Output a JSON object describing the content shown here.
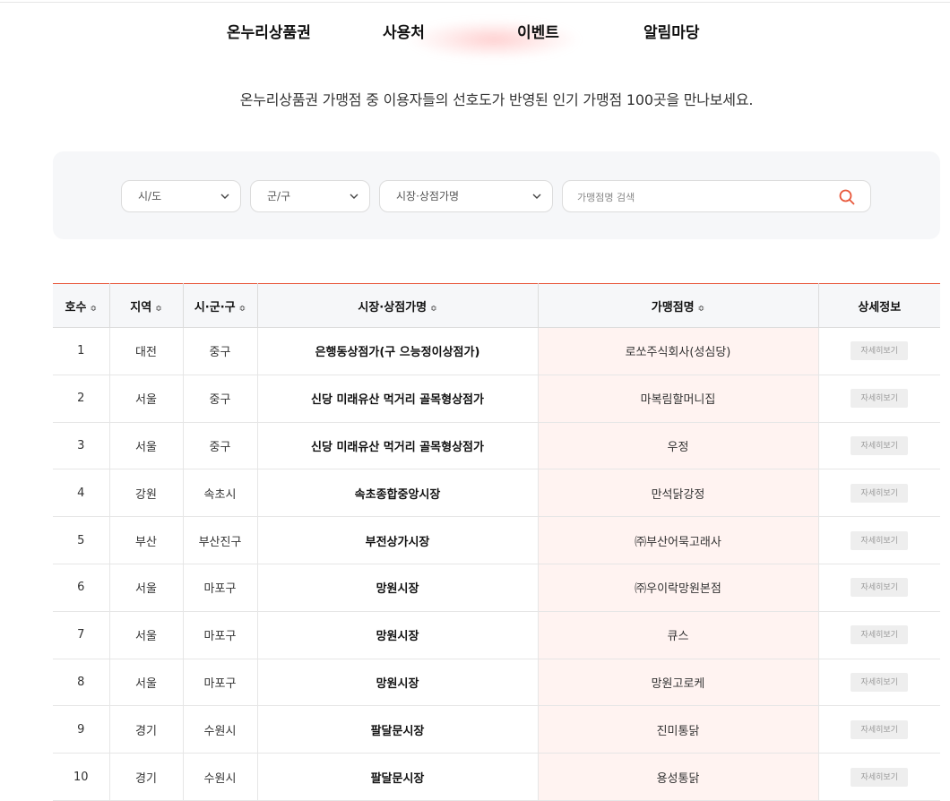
{
  "nav": {
    "items": [
      "온누리상품권",
      "사용처",
      "이벤트",
      "알림마당"
    ]
  },
  "subtitle": "온누리상품권 가맹점 중 이용자들의 선호도가 반영된 인기 가맹점 100곳을 만나보세요.",
  "filters": {
    "sido": "시/도",
    "gungu": "군/구",
    "market": "시장·상점가명",
    "search_placeholder": "가맹점명 검색"
  },
  "colors": {
    "accent": "#e8573a",
    "store_bg": "#fff3f1",
    "panel_bg": "#f6f7f9"
  },
  "table": {
    "headers": [
      "호수",
      "지역",
      "시·군·구",
      "시장·상점가명",
      "가맹점명",
      "상세정보"
    ],
    "sort_icon": "sort-updown-icon",
    "detail_label": "자세히보기",
    "rows": [
      {
        "no": "1",
        "region": "대전",
        "district": "중구",
        "market": "은행동상점가(구 으능정이상점가)",
        "store": "로쏘주식회사(성심당)"
      },
      {
        "no": "2",
        "region": "서울",
        "district": "중구",
        "market": "신당 미래유산 먹거리 골목형상점가",
        "store": "마복림할머니집"
      },
      {
        "no": "3",
        "region": "서울",
        "district": "중구",
        "market": "신당 미래유산 먹거리 골목형상점가",
        "store": "우정"
      },
      {
        "no": "4",
        "region": "강원",
        "district": "속초시",
        "market": "속초종합중앙시장",
        "store": "만석닭강정"
      },
      {
        "no": "5",
        "region": "부산",
        "district": "부산진구",
        "market": "부전상가시장",
        "store": "㈜부산어묵고래사"
      },
      {
        "no": "6",
        "region": "서울",
        "district": "마포구",
        "market": "망원시장",
        "store": "㈜우이락망원본점"
      },
      {
        "no": "7",
        "region": "서울",
        "district": "마포구",
        "market": "망원시장",
        "store": "큐스"
      },
      {
        "no": "8",
        "region": "서울",
        "district": "마포구",
        "market": "망원시장",
        "store": "망원고로케"
      },
      {
        "no": "9",
        "region": "경기",
        "district": "수원시",
        "market": "팔달문시장",
        "store": "진미통닭"
      },
      {
        "no": "10",
        "region": "경기",
        "district": "수원시",
        "market": "팔달문시장",
        "store": "용성통닭"
      }
    ]
  }
}
